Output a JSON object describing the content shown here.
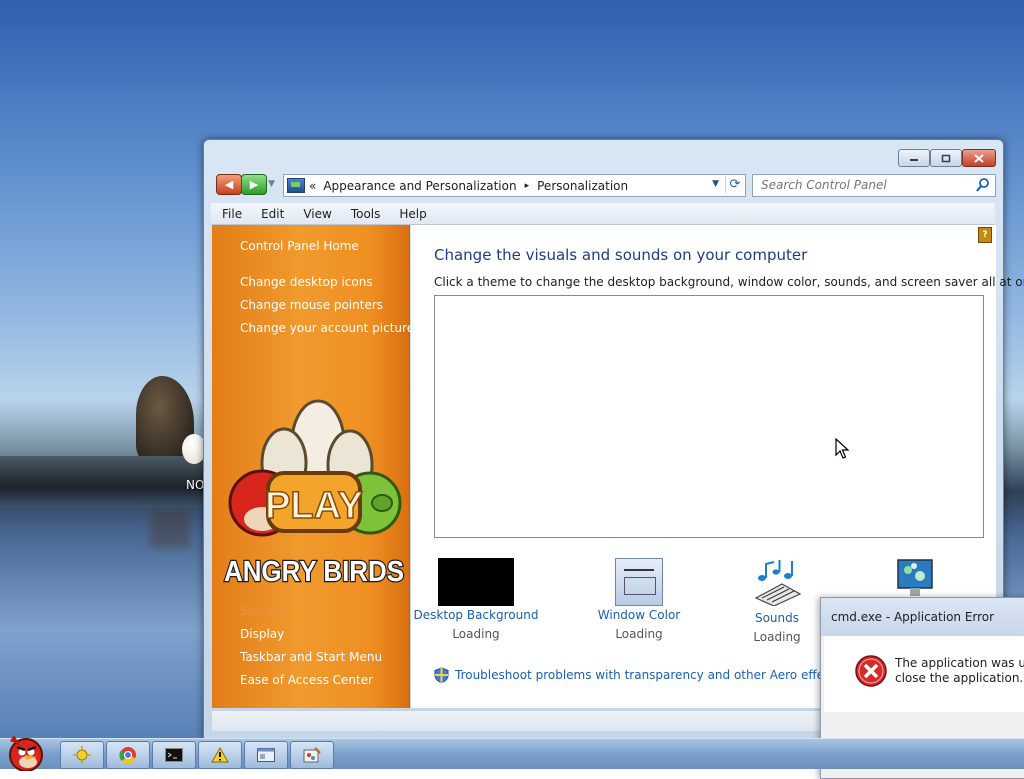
{
  "desktop": {
    "label": "NO"
  },
  "window": {
    "nav_back_icon": "back-arrow-icon",
    "nav_forward_icon": "forward-arrow-icon",
    "address": {
      "crumb_prefix": "«",
      "crumbs": [
        "Appearance and Personalization",
        "Personalization"
      ],
      "separator": "▸"
    },
    "search_placeholder": "Search Control Panel",
    "menu": [
      "File",
      "Edit",
      "View",
      "Tools",
      "Help"
    ],
    "sidebar": {
      "home": "Control Panel Home",
      "links": [
        "Change desktop icons",
        "Change mouse pointers",
        "Change your account picture"
      ],
      "see_also": "See also",
      "see_also_links": [
        "Display",
        "Taskbar and Start Menu",
        "Ease of Access Center"
      ],
      "art": {
        "play": "PLAY",
        "logo": "ANGRY BIRDS"
      }
    },
    "main": {
      "title": "Change the visuals and sounds on your computer",
      "description": "Click a theme to change the desktop background, window color, sounds, and screen saver all at once.",
      "tiles": [
        {
          "label": "Desktop Background",
          "status": "Loading"
        },
        {
          "label": "Window Color",
          "status": "Loading"
        },
        {
          "label": "Sounds",
          "status": "Loading"
        }
      ],
      "troubleshoot": "Troubleshoot problems with transparency and other Aero effects"
    }
  },
  "error_dialog": {
    "title": "cmd.exe - Application Error",
    "message_line1": "The application was unal",
    "message_line2": "close the application."
  },
  "taskbar": {
    "items": [
      "sun-icon",
      "chrome-icon",
      "cmd-icon",
      "warning-icon",
      "window-icon",
      "paint-icon"
    ]
  },
  "colors": {
    "sidebar_orange": "#f19a2e",
    "link_blue": "#1a5fb4",
    "title_blue": "#1e3b8a"
  }
}
